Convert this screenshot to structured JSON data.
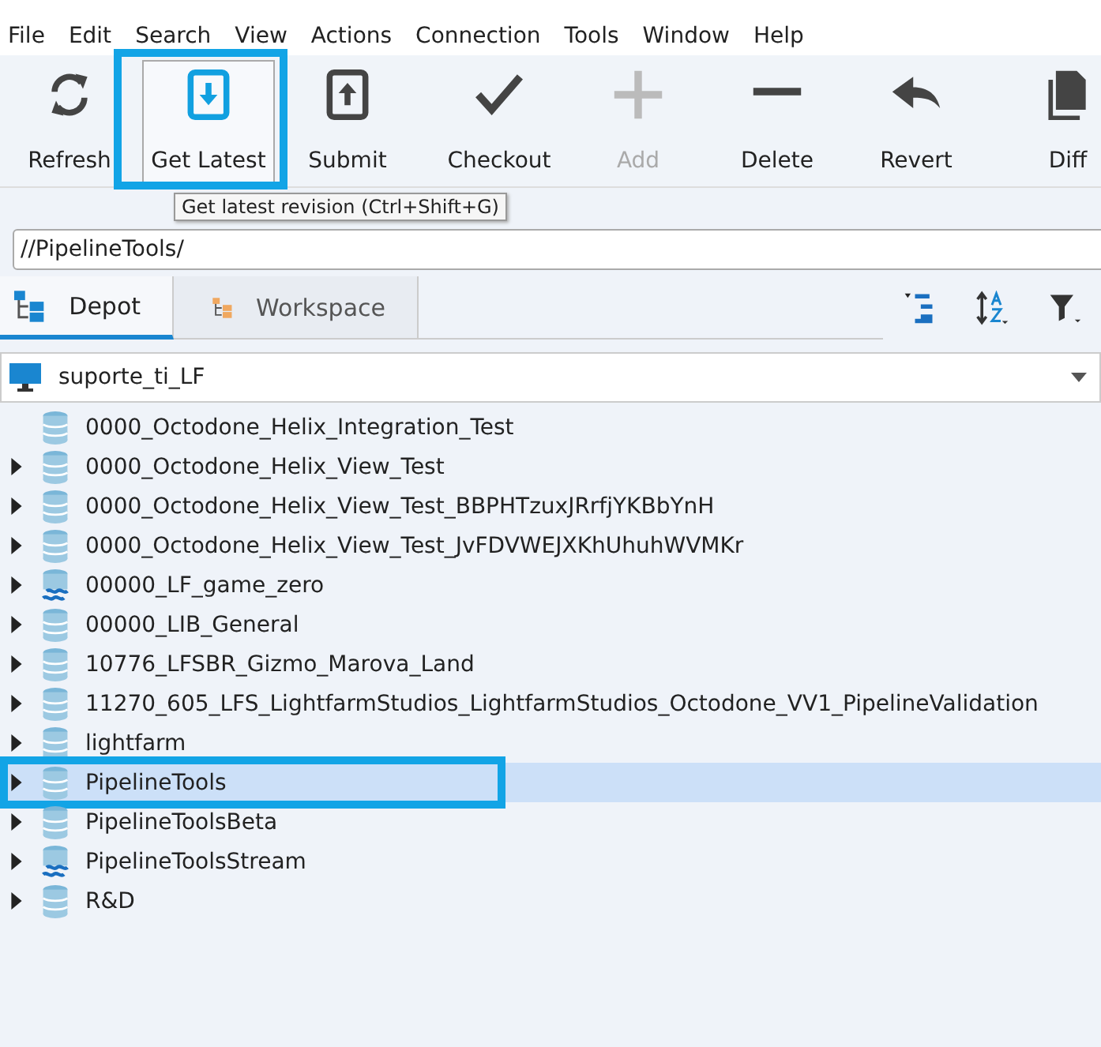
{
  "menu": [
    "File",
    "Edit",
    "Search",
    "View",
    "Actions",
    "Connection",
    "Tools",
    "Window",
    "Help"
  ],
  "toolbar": [
    {
      "label": "Refresh",
      "disabled": false,
      "highlighted": false
    },
    {
      "label": "Get Latest",
      "disabled": false,
      "highlighted": true
    },
    {
      "label": "Submit",
      "disabled": false,
      "highlighted": false
    },
    {
      "label": "Checkout",
      "disabled": false,
      "highlighted": false
    },
    {
      "label": "Add",
      "disabled": true,
      "highlighted": false
    },
    {
      "label": "Delete",
      "disabled": false,
      "highlighted": false
    },
    {
      "label": "Revert",
      "disabled": false,
      "highlighted": false
    },
    {
      "label": "Diff",
      "disabled": false,
      "highlighted": false
    }
  ],
  "tooltip": "Get latest revision (Ctrl+Shift+G)",
  "path": "//PipelineTools/",
  "tabs": [
    {
      "label": "Depot",
      "selected": true
    },
    {
      "label": "Workspace",
      "selected": false
    }
  ],
  "workspace": "suporte_ti_LF",
  "tree": [
    {
      "name": "0000_Octodone_Helix_Integration_Test",
      "kind": "depot",
      "expandable": false,
      "selected": false,
      "highlighted": false
    },
    {
      "name": "0000_Octodone_Helix_View_Test",
      "kind": "depot",
      "expandable": true,
      "selected": false,
      "highlighted": false
    },
    {
      "name": "0000_Octodone_Helix_View_Test_BBPHTzuxJRrfjYKBbYnH",
      "kind": "depot",
      "expandable": true,
      "selected": false,
      "highlighted": false
    },
    {
      "name": "0000_Octodone_Helix_View_Test_JvFDVWEJXKhUhuhWVMKr",
      "kind": "depot",
      "expandable": true,
      "selected": false,
      "highlighted": false
    },
    {
      "name": "00000_LF_game_zero",
      "kind": "stream",
      "expandable": true,
      "selected": false,
      "highlighted": false
    },
    {
      "name": "00000_LIB_General",
      "kind": "depot",
      "expandable": true,
      "selected": false,
      "highlighted": false
    },
    {
      "name": "10776_LFSBR_Gizmo_Marova_Land",
      "kind": "depot",
      "expandable": true,
      "selected": false,
      "highlighted": false
    },
    {
      "name": "11270_605_LFS_LightfarmStudios_LightfarmStudios_Octodone_VV1_PipelineValidation",
      "kind": "depot",
      "expandable": true,
      "selected": false,
      "highlighted": false
    },
    {
      "name": "lightfarm",
      "kind": "depot",
      "expandable": true,
      "selected": false,
      "highlighted": false
    },
    {
      "name": "PipelineTools",
      "kind": "depot",
      "expandable": true,
      "selected": true,
      "highlighted": true
    },
    {
      "name": "PipelineToolsBeta",
      "kind": "depot",
      "expandable": true,
      "selected": false,
      "highlighted": false
    },
    {
      "name": "PipelineToolsStream",
      "kind": "stream",
      "expandable": true,
      "selected": false,
      "highlighted": false
    },
    {
      "name": "R&D",
      "kind": "depot",
      "expandable": true,
      "selected": false,
      "highlighted": false
    }
  ]
}
